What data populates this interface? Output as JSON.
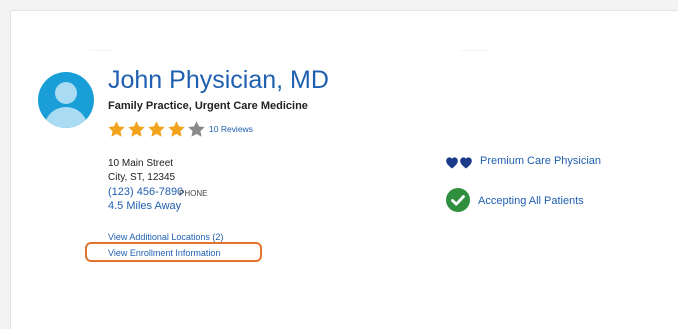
{
  "provider": {
    "name": "John Physician, MD",
    "specialties": "Family Practice, Urgent Care Medicine",
    "rating": 4,
    "rating_max": 5,
    "reviews_label": "10 Reviews",
    "address_line1": "10 Main Street",
    "address_line2": "City, ST, 12345",
    "phone": "(123) 456-7890",
    "phone_type": "PHONE",
    "distance": "4.5 Miles Away"
  },
  "links": {
    "additional_locations": "View Additional Locations (2)",
    "enrollment_info": "View Enrollment Information"
  },
  "badges": {
    "premium_label": "Premium Care Physician",
    "premium_icon": "heart-icon",
    "accepting_label": "Accepting All Patients",
    "accepting_icon": "check-circle-icon"
  },
  "colors": {
    "link_blue": "#1f5fb0",
    "star_gold": "#f2a31b",
    "star_empty": "#8a8a8a",
    "heart_navy": "#1c3a8a",
    "check_green": "#2f8f3e",
    "highlight_orange": "#e2742e",
    "avatar_blue": "#1a9ed8"
  }
}
